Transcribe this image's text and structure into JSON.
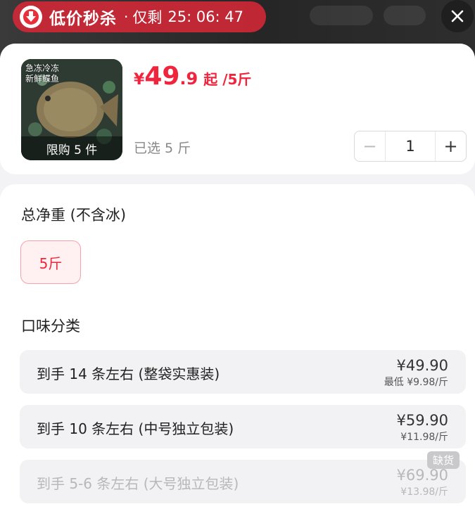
{
  "banner": {
    "title": "低价秒杀",
    "separator": "·",
    "remaining_label": "仅剩",
    "timer": "25: 06: 47"
  },
  "product": {
    "image_caption_line1": "急冻冷冻",
    "image_caption_line2": "新鲜鲽鱼",
    "purchase_limit": "限购 5 件",
    "price_currency": "¥",
    "price_integer": "49",
    "price_decimal": ".9",
    "price_suffix": "起 /5斤",
    "selected_text": "已选 5 斤",
    "quantity": "1",
    "minus_symbol": "−",
    "plus_symbol": "+"
  },
  "weight_section": {
    "title": "总净重 (不含冰)",
    "options": [
      "5斤"
    ],
    "selected": "5斤"
  },
  "flavor_section": {
    "title": "口味分类",
    "options": [
      {
        "name": "到手 14 条左右 (整袋实惠装)",
        "price": "¥49.90",
        "sub_price": "最低 ¥9.98/斤",
        "status": ""
      },
      {
        "name": "到手 10 条左右 (中号独立包装)",
        "price": "¥59.90",
        "sub_price": "¥11.98/斤",
        "status": ""
      },
      {
        "name": "到手 5-6 条左右 (大号独立包装)",
        "price": "¥69.90",
        "sub_price": "¥13.98/斤",
        "status": "缺货"
      }
    ]
  },
  "colors": {
    "accent": "#f0243c",
    "banner_red": "#d62837",
    "chip_border": "#f6a0ab",
    "chip_bg": "#fff0f2"
  },
  "icons": {
    "banner_badge": "down-arrow-icon",
    "close": "close-icon"
  }
}
